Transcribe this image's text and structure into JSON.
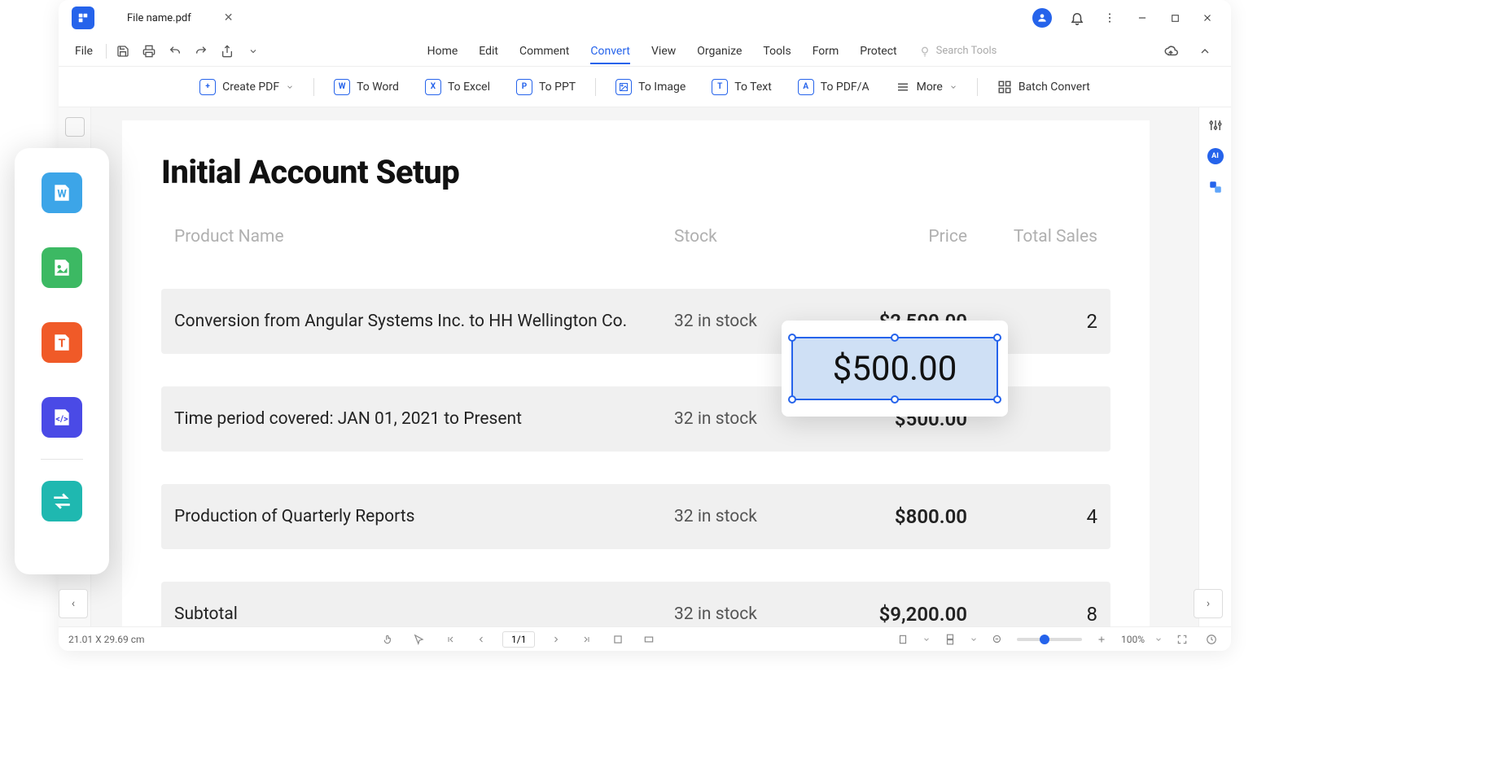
{
  "tab": {
    "name": "File name.pdf"
  },
  "menus": {
    "file": "File",
    "items": [
      "Home",
      "Edit",
      "Comment",
      "Convert",
      "View",
      "Organize",
      "Tools",
      "Form",
      "Protect"
    ],
    "active": "Convert",
    "search_placeholder": "Search Tools"
  },
  "toolbar": {
    "create": "Create PDF",
    "to_word": "To Word",
    "to_excel": "To Excel",
    "to_ppt": "To PPT",
    "to_image": "To Image",
    "to_text": "To Text",
    "to_pdfa": "To PDF/A",
    "more": "More",
    "batch": "Batch Convert"
  },
  "doc": {
    "title": "Initial Account Setup",
    "headers": {
      "name": "Product Name",
      "stock": "Stock",
      "price": "Price",
      "sales": "Total Sales"
    },
    "rows": [
      {
        "name": "Conversion from Angular Systems Inc. to HH Wellington Co.",
        "stock": "32 in stock",
        "price": "$2,500.00",
        "sales": "2"
      },
      {
        "name": "Time period covered: JAN 01, 2021 to Present",
        "stock": "32 in stock",
        "price": "$500.00",
        "sales": ""
      },
      {
        "name": "Production of Quarterly Reports",
        "stock": "32 in stock",
        "price": "$800.00",
        "sales": "4"
      },
      {
        "name": "Subtotal",
        "stock": "32 in stock",
        "price": "$9,200.00",
        "sales": "8"
      }
    ]
  },
  "edit": {
    "value": "$500.00"
  },
  "status": {
    "dim": "21.01 X 29.69 cm",
    "page": "1/1",
    "zoom": "100%"
  },
  "ai_label": "AI"
}
